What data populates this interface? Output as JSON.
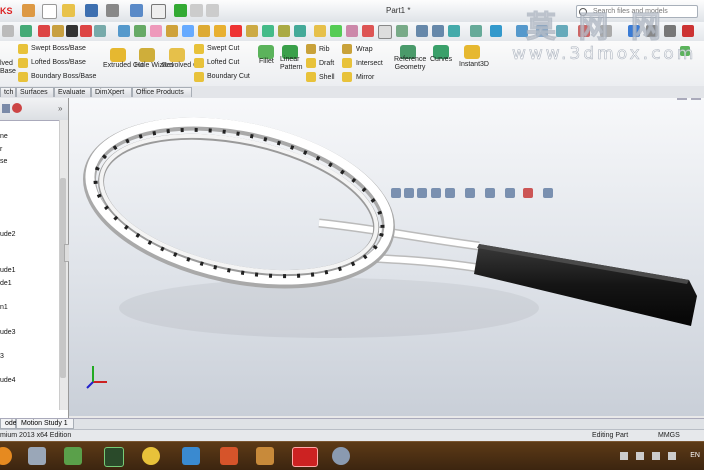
{
  "app": {
    "logo_text": "KS",
    "document_title": "Part1 *",
    "search_placeholder": "Search files and models"
  },
  "ribbon": {
    "left_stub": [
      "lved",
      "Base"
    ],
    "groups": [
      {
        "label": "Swept Boss/Base"
      },
      {
        "label": "Lofted Boss/Base"
      },
      {
        "label": "Boundary Boss/Base"
      },
      {
        "label": "Extruded Cut"
      },
      {
        "label": "Hole Wizard"
      },
      {
        "label": "Revolved Cut"
      },
      {
        "label": "Swept Cut"
      },
      {
        "label": "Lofted Cut"
      },
      {
        "label": "Boundary Cut"
      },
      {
        "label": "Fillet"
      },
      {
        "label": "Linear Pattern"
      },
      {
        "label": "Rib"
      },
      {
        "label": "Draft"
      },
      {
        "label": "Shell"
      },
      {
        "label": "Wrap"
      },
      {
        "label": "Intersect"
      },
      {
        "label": "Mirror"
      },
      {
        "label": "Reference Geometry"
      },
      {
        "label": "Curves"
      },
      {
        "label": "Instant3D"
      }
    ]
  },
  "tabs": [
    "tch",
    "Surfaces",
    "Evaluate",
    "DimXpert",
    "Office Products"
  ],
  "feature_tree": [
    "ne",
    "r",
    "se",
    "ude2",
    "ude1",
    "de1",
    "n1",
    "ude3",
    "3",
    "ude4"
  ],
  "bottom_tabs": [
    "odel",
    "Motion Study 1"
  ],
  "status": {
    "edition": "mium 2013 x64 Edition",
    "mode": "Editing Part",
    "units": "MMGS"
  },
  "taskbar": {
    "tray_lang": "EN"
  },
  "watermark": {
    "line1": "莫 网 网",
    "line2": "www.3dmox.com"
  },
  "colors": {
    "grip": "#1b1b1b",
    "frame": "#ffffff",
    "taskbar": "#4a2e13",
    "accent": "#d22222"
  }
}
